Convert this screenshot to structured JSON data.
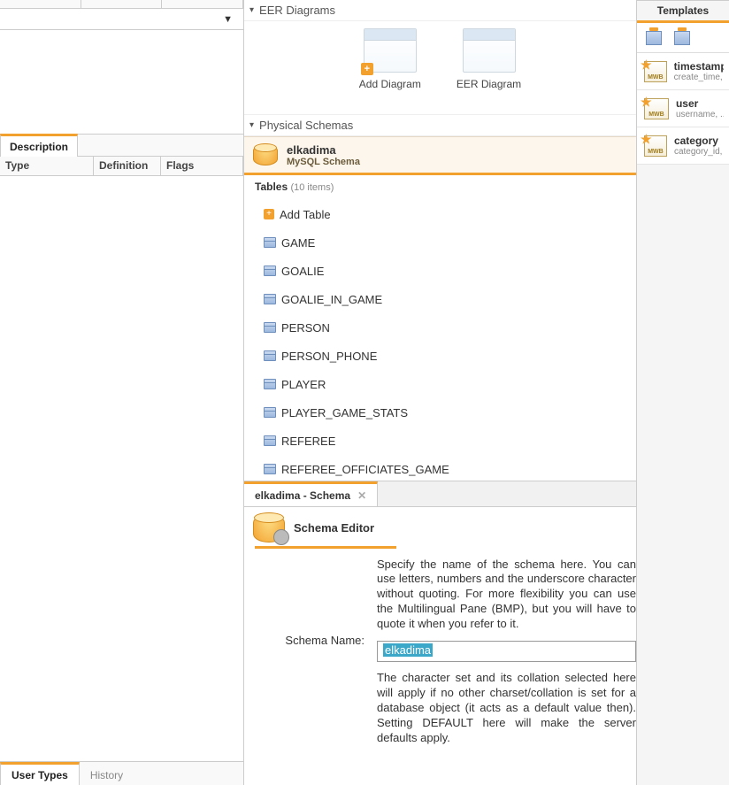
{
  "left": {
    "desc_tab": "Description",
    "grid_cols": {
      "type": "Type",
      "definition": "Definition",
      "flags": "Flags"
    },
    "bottom_tabs": {
      "user_types": "User Types",
      "history": "History"
    }
  },
  "mid": {
    "eer_header": "EER Diagrams",
    "add_diagram": "Add Diagram",
    "eer_diagram": "EER Diagram",
    "phys_header": "Physical Schemas",
    "schema": {
      "name": "elkadima",
      "subtitle": "MySQL Schema"
    },
    "tables_label": "Tables",
    "tables_count": "(10 items)",
    "add_table": "Add Table",
    "tables": [
      "GAME",
      "GOALIE",
      "GOALIE_IN_GAME",
      "PERSON",
      "PERSON_PHONE",
      "PLAYER",
      "PLAYER_GAME_STATS",
      "REFEREE",
      "REFEREE_OFFICIATES_GAME"
    ]
  },
  "editor": {
    "tab_title": "elkadima - Schema",
    "title": "Schema Editor",
    "help1": "Specify the name of the schema here. You can use letters, numbers and the underscore character without quoting. For more flexibility you can use the Multilingual Pane (BMP), but you will have to quote it when you refer to it.",
    "name_label": "Schema Name:",
    "name_value": "elkadima",
    "help2": "The character set and its collation selected here will apply if no other charset/collation is set for a database object (it acts as a default value then). Setting DEFAULT here will make the server defaults apply."
  },
  "templates": {
    "header": "Templates",
    "items": [
      {
        "title": "timestamps",
        "sub": "create_time, ..."
      },
      {
        "title": "user",
        "sub": "username, ..."
      },
      {
        "title": "category",
        "sub": "category_id, ..."
      }
    ]
  }
}
